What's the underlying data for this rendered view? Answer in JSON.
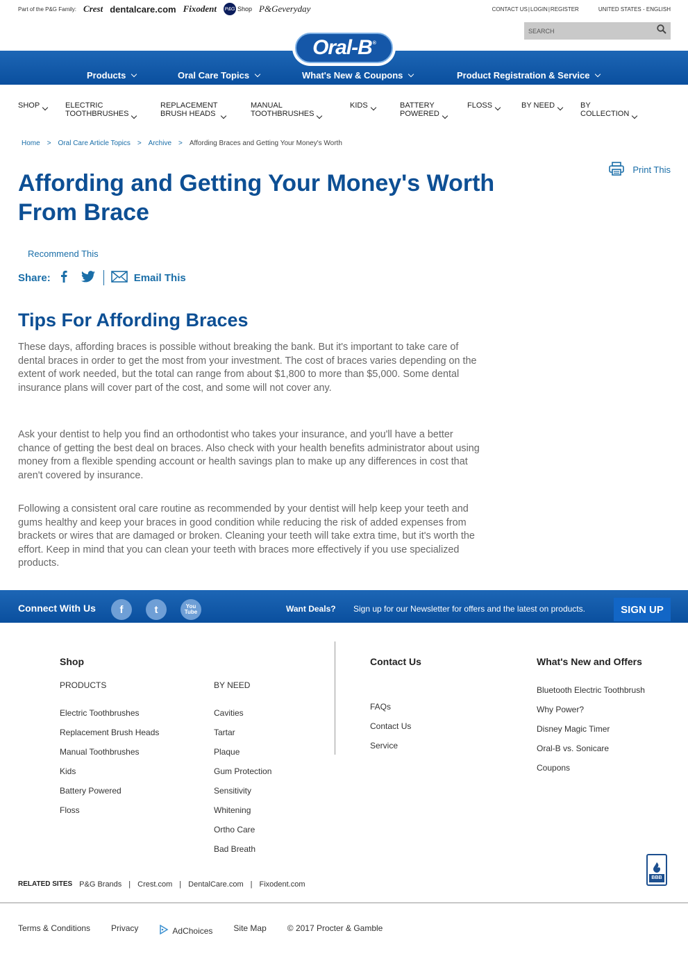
{
  "family": {
    "label": "Part of the P&G Family:",
    "brands": [
      "Crest",
      "dentalcare.com",
      "Fixodent",
      "Shop",
      "P&Geveryday"
    ],
    "pg_badge": "P&G"
  },
  "util": {
    "contact": "CONTACT US",
    "login": "LOGIN",
    "register": "REGISTER",
    "locale": "UNITED STATES - ENGLISH",
    "search_placeholder": "SEARCH"
  },
  "logo": {
    "text": "Oral-B",
    "mark": "®"
  },
  "main_nav": [
    "Products",
    "Oral Care Topics",
    "What's New & Coupons",
    "Product Registration & Service"
  ],
  "sub_nav": [
    "SHOP",
    "ELECTRIC\nTOOTHBRUSHES",
    "REPLACEMENT\nBRUSH HEADS",
    "MANUAL\nTOOTHBRUSHES",
    "KIDS",
    "BATTERY\nPOWERED",
    "FLOSS",
    "BY NEED",
    "BY\nCOLLECTION"
  ],
  "breadcrumb": [
    "Home",
    "Oral Care Article Topics",
    "Archive",
    "Affording Braces and Getting Your Money's Worth"
  ],
  "breadcrumb_sep": ">",
  "print_label": "Print This",
  "article": {
    "title": "Affording and Getting Your Money's Worth From Brace",
    "recommend": "Recommend This",
    "share_label": "Share:",
    "email_label": "Email This",
    "subtitle": "Tips For Affording Braces",
    "paragraphs": [
      "These days, affording braces is possible without breaking the bank. But it's important to take care of dental braces in order to get the most from your investment. The cost of braces varies depending on the extent of work needed, but the total can range from about $1,800 to more than $5,000. Some dental insurance plans will cover part of the cost, and some will not cover any.",
      "Ask your dentist to help you find an orthodontist who takes your insurance, and you'll have a better chance of getting the best deal on braces. Also check with your health benefits administrator about using money from a flexible spending account or health savings plan to make up any differences in cost that aren't covered by insurance.",
      "Following a consistent oral care routine as recommended by your dentist will help keep your teeth and gums healthy and keep your braces in good condition while reducing the risk of added expenses from brackets or wires that are damaged or broken. Cleaning your teeth will take extra time, but it's worth the effort. Keep in mind that you can clean your teeth with braces more effectively if you use specialized products."
    ]
  },
  "connect": {
    "title": "Connect With Us",
    "deals": "Want Deals?",
    "newsletter": "Sign up for our Newsletter for offers and the latest on products.",
    "signup": "SIGN UP",
    "social": [
      "f",
      "t",
      "You Tube"
    ]
  },
  "footer": {
    "shop": "Shop",
    "products_head": "PRODUCTS",
    "products": [
      "Electric Toothbrushes",
      "Replacement Brush Heads",
      "Manual Toothbrushes",
      "Kids",
      "Battery Powered",
      "Floss"
    ],
    "byneed_head": "BY NEED",
    "byneed": [
      "Cavities",
      "Tartar",
      "Plaque",
      "Gum Protection",
      "Sensitivity",
      "Whitening",
      "Ortho Care",
      "Bad Breath"
    ],
    "contact_head": "Contact Us",
    "contact": [
      "FAQs",
      "Contact Us",
      "Service"
    ],
    "whatsnew_head": "What's New and Offers",
    "whatsnew": [
      "Bluetooth Electric Toothbrush",
      "Why Power?",
      "Disney Magic Timer",
      "Oral-B vs. Sonicare",
      "Coupons"
    ],
    "bbb": "BBB"
  },
  "related": {
    "label": "RELATED SITES",
    "sites": [
      "P&G Brands",
      "Crest.com",
      "DentalCare.com",
      "Fixodent.com"
    ],
    "sep": "|"
  },
  "bottom_links": {
    "terms": "Terms & Conditions",
    "privacy": "Privacy",
    "adchoices": "AdChoices",
    "sitemap": "Site Map",
    "copyright": "© 2017 Procter & Gamble"
  }
}
